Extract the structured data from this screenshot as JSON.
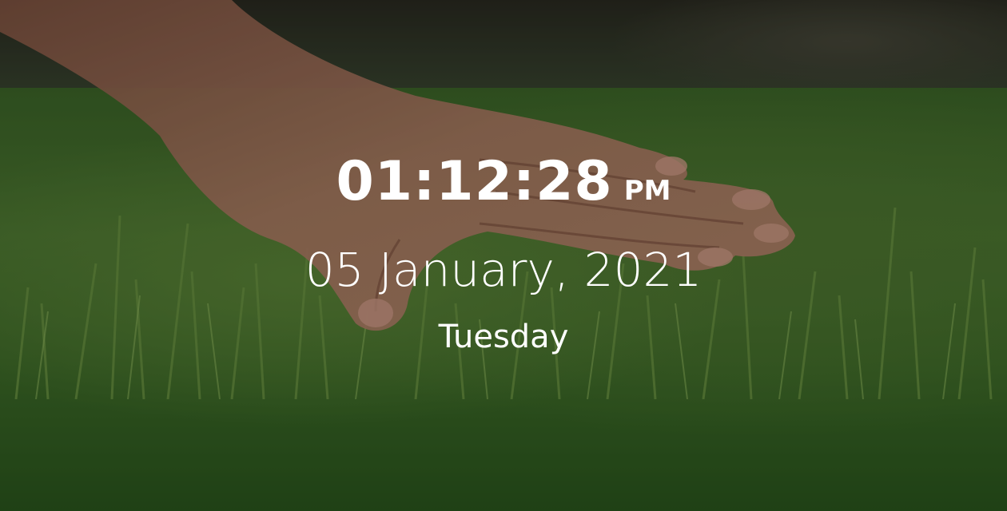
{
  "clock": {
    "time": "01:12:28",
    "meridiem": "PM",
    "date": "05 January, 2021",
    "weekday": "Tuesday"
  },
  "background": {
    "image": "hand-touching-grass",
    "colors": {
      "grass": "#4f7d33",
      "grass_dark": "#2c5a1e",
      "skin": "#b07a62",
      "text": "#ffffff"
    }
  }
}
